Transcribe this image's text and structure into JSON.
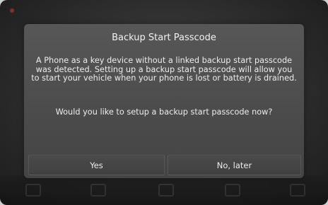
{
  "dialog": {
    "title": "Backup Start Passcode",
    "message": "A Phone as a key device without a linked backup start passcode was detected. Setting up a backup start passcode will allow you to start your vehicle when your phone is lost or battery is drained.",
    "question": "Would you like to setup a backup start passcode now?",
    "buttons": {
      "yes": "Yes",
      "no_later": "No, later"
    }
  },
  "colors": {
    "dialog_background": "#4d4d4d",
    "text": "#ededed",
    "screen_background": "#2e2e2e",
    "status_indicator": "#dc3c3c"
  },
  "icons": {
    "status_dot": "red-status-dot-icon",
    "nav_icons": [
      "nav-icon-1",
      "nav-icon-2",
      "nav-icon-3",
      "nav-icon-4",
      "nav-icon-5"
    ]
  }
}
